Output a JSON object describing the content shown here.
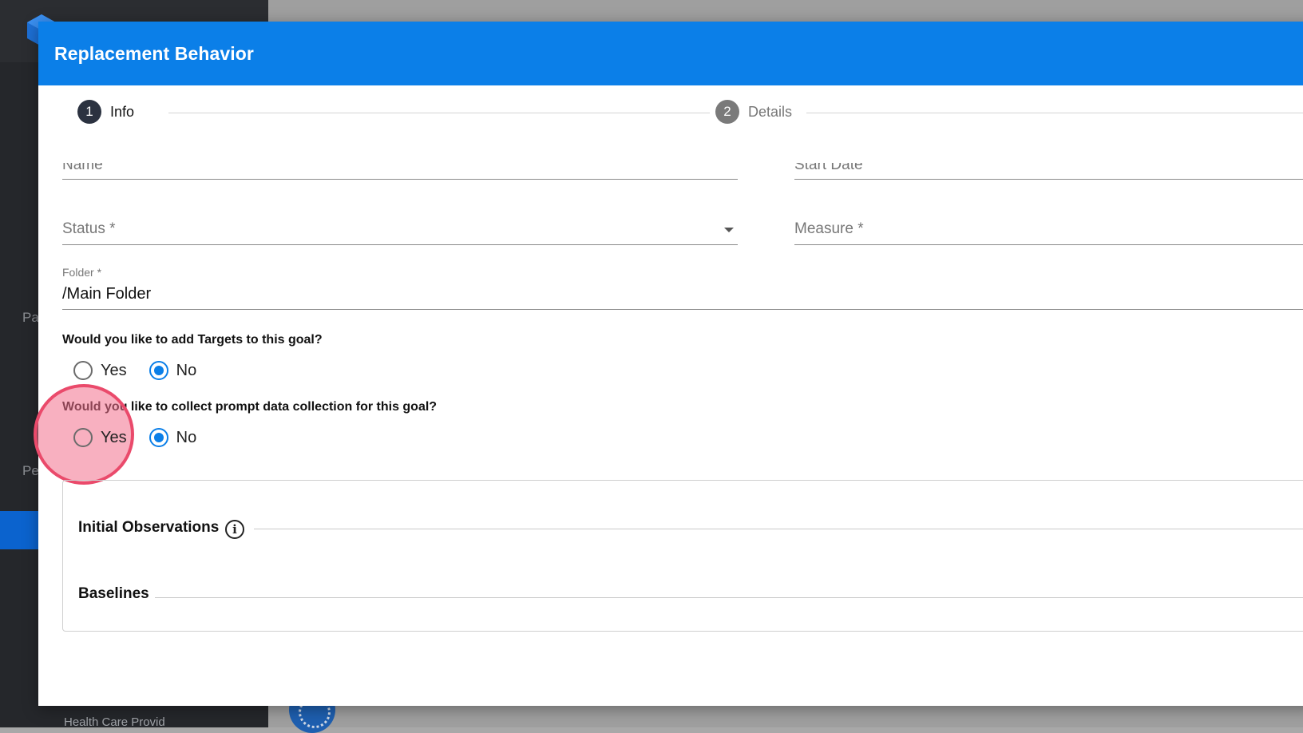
{
  "background": {
    "sidebar_texts": [
      "Pa",
      "Pe"
    ],
    "bottom_text": "Health Care Provid"
  },
  "dialog": {
    "title": "Replacement Behavior",
    "stepper": [
      {
        "number": "1",
        "label": "Info",
        "state": "active"
      },
      {
        "number": "2",
        "label": "Details",
        "state": "inactive"
      }
    ],
    "fields": {
      "name_label": "Name",
      "start_date_label": "Start Date",
      "status_label": "Status *",
      "measure_label": "Measure *",
      "folder_label": "Folder *",
      "folder_value": "/Main Folder"
    },
    "questions": [
      {
        "text": "Would you like to add Targets to this goal?",
        "options": [
          {
            "label": "Yes",
            "checked": false
          },
          {
            "label": "No",
            "checked": true
          }
        ]
      },
      {
        "text": "Would you like to collect prompt data collection for this goal?",
        "options": [
          {
            "label": "Yes",
            "checked": false
          },
          {
            "label": "No",
            "checked": true
          }
        ]
      }
    ],
    "sections": {
      "initial_observations": "Initial Observations",
      "baselines": "Baselines"
    }
  },
  "colors": {
    "header": "#0b7fe8",
    "radio_checked": "#0b7fe8",
    "highlight": "#ea4a6b"
  }
}
